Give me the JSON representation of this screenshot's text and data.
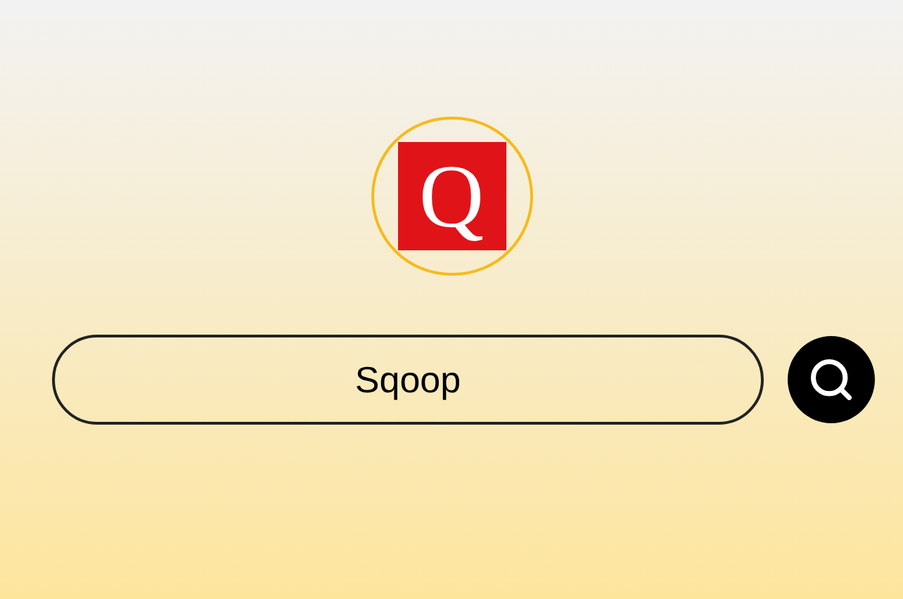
{
  "logo": {
    "letter": "Q"
  },
  "search": {
    "value": "Sqoop"
  }
}
